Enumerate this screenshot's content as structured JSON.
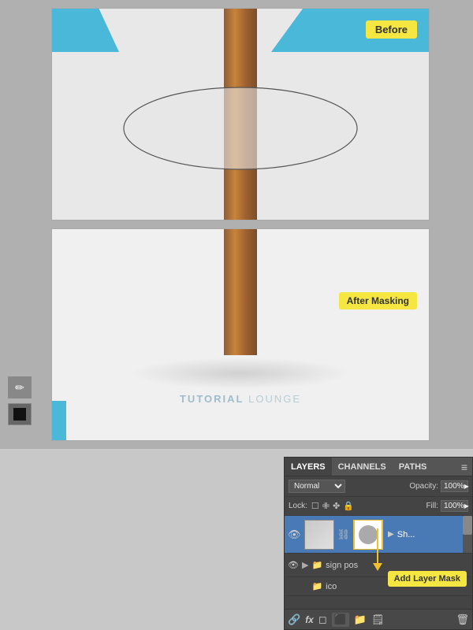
{
  "before_label": "Before",
  "after_label": "After Masking",
  "tutorial_text": "TUTORIAL LOUNGE",
  "tutorial_bold": "TUTORIAL",
  "layers": {
    "tabs": [
      "LAYERS",
      "CHANNELS",
      "PATHS"
    ],
    "active_tab": "LAYERS",
    "blend_mode": "Normal",
    "opacity_label": "Opacity:",
    "opacity_value": "100%",
    "fill_label": "Fill:",
    "fill_value": "100%",
    "lock_label": "Lock:",
    "layer_items": [
      {
        "name": "Sh...",
        "visible": true,
        "has_mask": true
      },
      {
        "name": "sign pos",
        "visible": true,
        "has_mask": false
      },
      {
        "name": "ico",
        "visible": true,
        "has_mask": false
      }
    ]
  },
  "tools": [
    {
      "name": "brush-tool",
      "icon": "✏"
    },
    {
      "name": "foreground-bg-tool",
      "icon": "◼"
    }
  ],
  "add_layer_mask_label": "Add Layer Mask",
  "toolbar_icons": [
    "🔗",
    "fx",
    "◻",
    "⊕",
    "✂",
    "🗑"
  ],
  "arrow_annotation": {
    "color": "#f0c030"
  }
}
